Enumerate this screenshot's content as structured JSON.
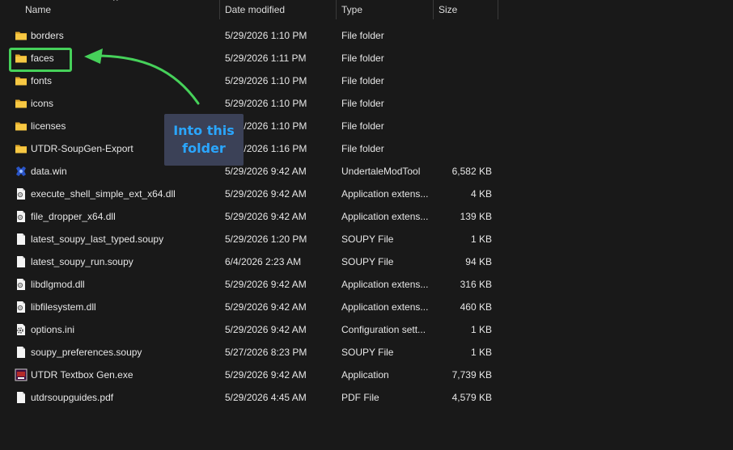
{
  "columns": {
    "name": "Name",
    "date": "Date modified",
    "type": "Type",
    "size": "Size"
  },
  "sort_caret": "^",
  "files": [
    {
      "name": "borders",
      "date": "5/29/2026 1:10 PM",
      "type": "File folder",
      "size": "",
      "icon": "folder-icon"
    },
    {
      "name": "faces",
      "date": "5/29/2026 1:11 PM",
      "type": "File folder",
      "size": "",
      "icon": "folder-icon"
    },
    {
      "name": "fonts",
      "date": "5/29/2026 1:10 PM",
      "type": "File folder",
      "size": "",
      "icon": "folder-icon"
    },
    {
      "name": "icons",
      "date": "5/29/2026 1:10 PM",
      "type": "File folder",
      "size": "",
      "icon": "folder-icon"
    },
    {
      "name": "licenses",
      "date": "5/29/2026 1:10 PM",
      "type": "File folder",
      "size": "",
      "icon": "folder-icon"
    },
    {
      "name": "UTDR-SoupGen-Export",
      "date": "5/29/2026 1:16 PM",
      "type": "File folder",
      "size": "",
      "icon": "folder-icon"
    },
    {
      "name": "data.win",
      "date": "5/29/2026 9:42 AM",
      "type": "UndertaleModTool",
      "size": "6,582 KB",
      "icon": "undertale-mod-tool-icon"
    },
    {
      "name": "execute_shell_simple_ext_x64.dll",
      "date": "5/29/2026 9:42 AM",
      "type": "Application extens...",
      "size": "4 KB",
      "icon": "dll-file-icon"
    },
    {
      "name": "file_dropper_x64.dll",
      "date": "5/29/2026 9:42 AM",
      "type": "Application extens...",
      "size": "139 KB",
      "icon": "dll-file-icon"
    },
    {
      "name": "latest_soupy_last_typed.soupy",
      "date": "5/29/2026 1:20 PM",
      "type": "SOUPY File",
      "size": "1 KB",
      "icon": "blank-file-icon"
    },
    {
      "name": "latest_soupy_run.soupy",
      "date": "6/4/2026 2:23 AM",
      "type": "SOUPY File",
      "size": "94 KB",
      "icon": "blank-file-icon"
    },
    {
      "name": "libdlgmod.dll",
      "date": "5/29/2026 9:42 AM",
      "type": "Application extens...",
      "size": "316 KB",
      "icon": "dll-file-icon"
    },
    {
      "name": "libfilesystem.dll",
      "date": "5/29/2026 9:42 AM",
      "type": "Application extens...",
      "size": "460 KB",
      "icon": "dll-file-icon"
    },
    {
      "name": "options.ini",
      "date": "5/29/2026 9:42 AM",
      "type": "Configuration sett...",
      "size": "1 KB",
      "icon": "config-file-icon"
    },
    {
      "name": "soupy_preferences.soupy",
      "date": "5/27/2026 8:23 PM",
      "type": "SOUPY File",
      "size": "1 KB",
      "icon": "blank-file-icon"
    },
    {
      "name": "UTDR Textbox Gen.exe",
      "date": "5/29/2026 9:42 AM",
      "type": "Application",
      "size": "7,739 KB",
      "icon": "exe-app-icon"
    },
    {
      "name": "utdrsoupguides.pdf",
      "date": "5/29/2026 4:45 AM",
      "type": "PDF File",
      "size": "4,579 KB",
      "icon": "blank-file-icon"
    }
  ],
  "annotation": {
    "callout_line1": "Into this",
    "callout_line2": "folder",
    "highlight_color": "#46d15a",
    "callout_text_color": "#2aa6ff"
  }
}
